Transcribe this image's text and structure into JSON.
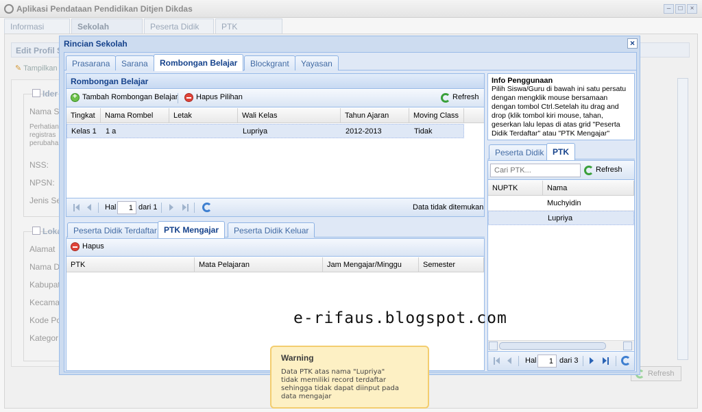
{
  "app": {
    "title": "Aplikasi Pendataan Pendidikan Ditjen Dikdas",
    "tabs": [
      "Informasi",
      "Sekolah",
      "Peserta Didik",
      "PTK"
    ],
    "active_tab": "Sekolah"
  },
  "background": {
    "panel_title": "Edit Profil S",
    "toolbar_label": "Tampilkan",
    "section1_legend": "Ider",
    "fields1": [
      "Nama S",
      "Perhatian",
      "registras",
      "perubaha",
      "NSS:",
      "NPSN:",
      "Jenis Se"
    ],
    "section2_legend": "Loka",
    "fields2": [
      "Alamat",
      "Nama D",
      "Kabupat",
      "Kecama",
      "Kode Po",
      "Kategor"
    ],
    "refresh_label": "Refresh"
  },
  "dialog": {
    "title": "Rincian Sekolah",
    "tabs": [
      "Prasarana",
      "Sarana",
      "Rombongan Belajar",
      "Blockgrant",
      "Yayasan"
    ],
    "active_tab": "Rombongan Belajar"
  },
  "rombel": {
    "header": "Rombongan Belajar",
    "add_label": "Tambah Rombongan Belajar",
    "delete_label": "Hapus Pilihan",
    "refresh_label": "Refresh",
    "columns": [
      "Tingkat",
      "Nama Rombel",
      "Letak",
      "Wali Kelas",
      "Tahun Ajaran",
      "Moving Class"
    ],
    "rows": [
      {
        "tingkat": "Kelas 1",
        "nama": "1 a",
        "letak": "",
        "wali": "Lupriya",
        "tahun": "2012-2013",
        "moving": "Tidak"
      }
    ],
    "pager": {
      "hal": "Hal",
      "page": "1",
      "dari": "dari 1",
      "status": "Data tidak ditemukan"
    }
  },
  "subtabs": {
    "tabs": [
      "Peserta Didik Terdaftar",
      "PTK Mengajar",
      "Peserta Didik Keluar"
    ],
    "active_tab": "PTK Mengajar",
    "delete_label": "Hapus",
    "columns": [
      "PTK",
      "Mata Pelajaran",
      "Jam Mengajar/Minggu",
      "Semester"
    ]
  },
  "info": {
    "title": "Info Penggunaan",
    "lines": [
      "Pilih Siswa/Guru di bawah ini satu persatu",
      "dengan mengklik mouse bersamaan",
      "dengan tombol Ctrl.Setelah itu drag and",
      "drop (klik tombol kiri mouse, tahan,",
      "geserkan lalu lepas di atas grid \"Peserta",
      "Didik Terdaftar\" atau \"PTK Mengajar\""
    ]
  },
  "right_panel": {
    "tabs": [
      "Peserta Didik",
      "PTK"
    ],
    "active_tab": "PTK",
    "search_placeholder": "Cari PTK...",
    "refresh_label": "Refresh",
    "columns": [
      "NUPTK",
      "Nama"
    ],
    "rows": [
      {
        "nuptk": "",
        "nama": "Muchyidin"
      },
      {
        "nuptk": "",
        "nama": "Lupriya"
      }
    ],
    "pager": {
      "hal": "Hal",
      "page": "1",
      "dari": "dari 3"
    }
  },
  "watermark": "e-rifaus.blogspot.com",
  "toast": {
    "title": "Warning",
    "lines": [
      "Data PTK atas nama \"Lupriya\"",
      "tidak memiliki record terdaftar",
      "sehingga tidak dapat diinput pada",
      "data mengajar"
    ]
  },
  "colors": {
    "accent": "#15428b",
    "panel_border": "#99bbe8",
    "warning_bg": "#fdf0c4"
  }
}
